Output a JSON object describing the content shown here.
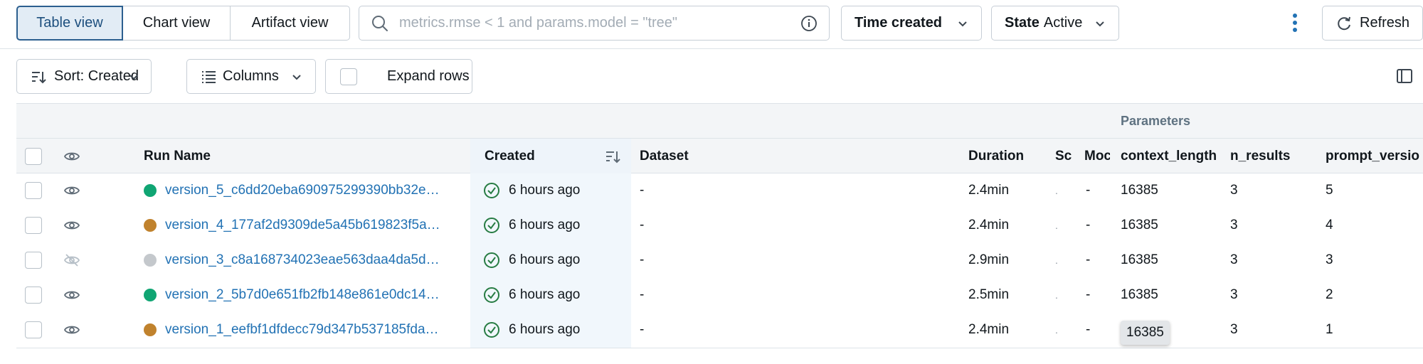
{
  "toolbar": {
    "views": [
      {
        "label": "Table view",
        "active": true
      },
      {
        "label": "Chart view",
        "active": false
      },
      {
        "label": "Artifact view",
        "active": false
      }
    ],
    "search_placeholder": "metrics.rmse < 1 and params.model = \"tree\"",
    "time_filter_label": "Time created",
    "state_label": "State",
    "state_value": "Active",
    "refresh_label": "Refresh"
  },
  "subtoolbar": {
    "sort_label": "Sort: Created",
    "columns_label": "Columns",
    "expand_rows_label": "Expand rows"
  },
  "table": {
    "group_header": "Parameters",
    "columns": {
      "run_name": "Run Name",
      "created": "Created",
      "dataset": "Dataset",
      "duration": "Duration",
      "source": "Sc",
      "models": "Moc",
      "context_length": "context_length",
      "n_results": "n_results",
      "prompt_version": "prompt_versio"
    },
    "colors": {
      "green": "#10a573",
      "orange": "#c0822d",
      "gray": "#c4c8cc",
      "link": "#2272b4",
      "success": "#277c43"
    },
    "rows": [
      {
        "color": "#10a573",
        "visible": true,
        "name": "version_5_c6dd20eba690975299390bb32e…",
        "created": "6 hours ago",
        "dataset": "-",
        "duration": "2.4min",
        "source": ".",
        "models": "-",
        "context_length": "16385",
        "n_results": "3",
        "prompt_version": "5"
      },
      {
        "color": "#c0822d",
        "visible": true,
        "name": "version_4_177af2d9309de5a45b619823f5a…",
        "created": "6 hours ago",
        "dataset": "-",
        "duration": "2.4min",
        "source": ".",
        "models": "-",
        "context_length": "16385",
        "n_results": "3",
        "prompt_version": "4"
      },
      {
        "color": "#c4c8cc",
        "visible": false,
        "name": "version_3_c8a168734023eae563daa4da5d…",
        "created": "6 hours ago",
        "dataset": "-",
        "duration": "2.9min",
        "source": ".",
        "models": "-",
        "context_length": "16385",
        "n_results": "3",
        "prompt_version": "3"
      },
      {
        "color": "#10a573",
        "visible": true,
        "name": "version_2_5b7d0e651fb2fb148e861e0dc14…",
        "created": "6 hours ago",
        "dataset": "-",
        "duration": "2.5min",
        "source": ".",
        "models": "-",
        "context_length": "16385",
        "n_results": "3",
        "prompt_version": "2"
      },
      {
        "color": "#c0822d",
        "visible": true,
        "name": "version_1_eefbf1dfdecc79d347b537185fda…",
        "created": "6 hours ago",
        "dataset": "-",
        "duration": "2.4min",
        "source": ".",
        "models": "-",
        "context_length": "16385",
        "n_results": "3",
        "prompt_version": "1"
      }
    ]
  }
}
